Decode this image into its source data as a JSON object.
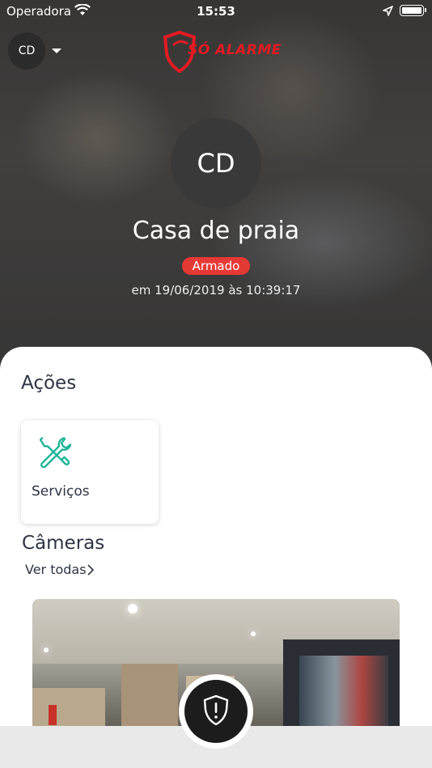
{
  "status_bar": {
    "carrier": "Operadora",
    "time": "15:53"
  },
  "header": {
    "account_initials": "CD",
    "logo_text": "SÓ ALARME"
  },
  "place": {
    "initials": "CD",
    "name": "Casa de praia",
    "status": "Armado",
    "status_color": "#e53935",
    "date": "em 19/06/2019 às 10:39:17"
  },
  "actions": {
    "title": "Ações",
    "items": [
      {
        "label": "Serviços",
        "icon": "tools-icon"
      }
    ]
  },
  "cameras": {
    "title": "Câmeras",
    "see_all": "Ver todas"
  },
  "colors": {
    "accent": "#1fb59a",
    "text": "#2d3444",
    "brand": "#e31b23"
  }
}
